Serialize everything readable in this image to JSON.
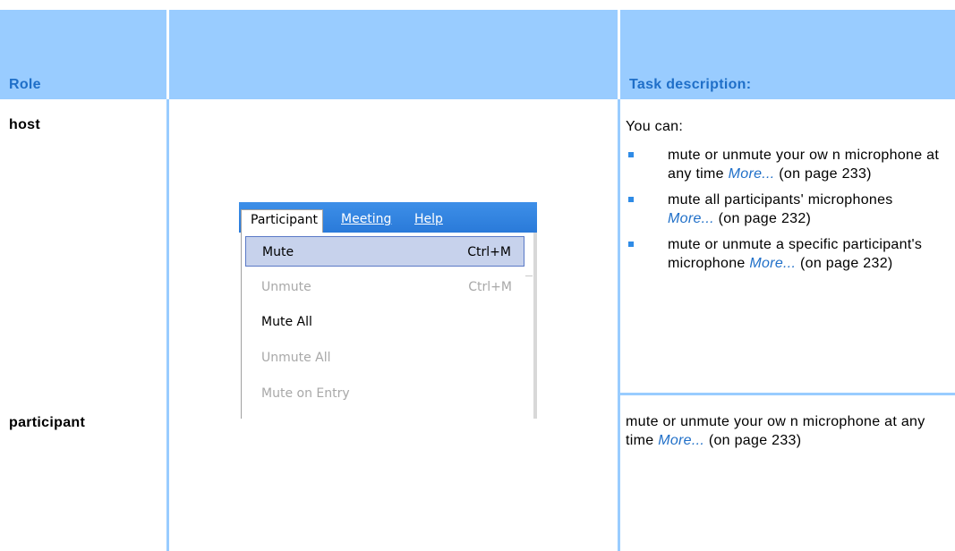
{
  "table": {
    "header": {
      "role": "Role",
      "task": "Task description:"
    },
    "host": {
      "role": "host",
      "intro": "You can:",
      "bullets": [
        {
          "text": "mute or unmute your ow n microphone at any time",
          "more": "More...",
          "page": "(on page 233)"
        },
        {
          "text": "mute all participants' microphones",
          "more": "More...",
          "page": "(on page 232)"
        },
        {
          "text": "mute or unmute a specific participant's microphone",
          "more": "More...",
          "page": "(on page 232)"
        }
      ]
    },
    "participant": {
      "role": "participant",
      "text": "mute or unmute your ow n microphone at any time",
      "more": "More...",
      "page": "(on page 233)"
    }
  },
  "menu": {
    "bar": {
      "participant": "Participant",
      "meeting": "Meeting",
      "help": "Help"
    },
    "items": {
      "mute": {
        "label": "Mute",
        "shortcut": "Ctrl+M"
      },
      "unmute": {
        "label": "Unmute",
        "shortcut": "Ctrl+M"
      },
      "mute_all": {
        "label": "Mute All"
      },
      "unmute_all": {
        "label": "Unmute All"
      },
      "mute_on_entry": {
        "label": "Mute on Entry"
      }
    }
  },
  "colors": {
    "header_band": "#99ccff",
    "header_text": "#1f6fc8",
    "link": "#1f6fc8",
    "bullet": "#2f8be6"
  }
}
